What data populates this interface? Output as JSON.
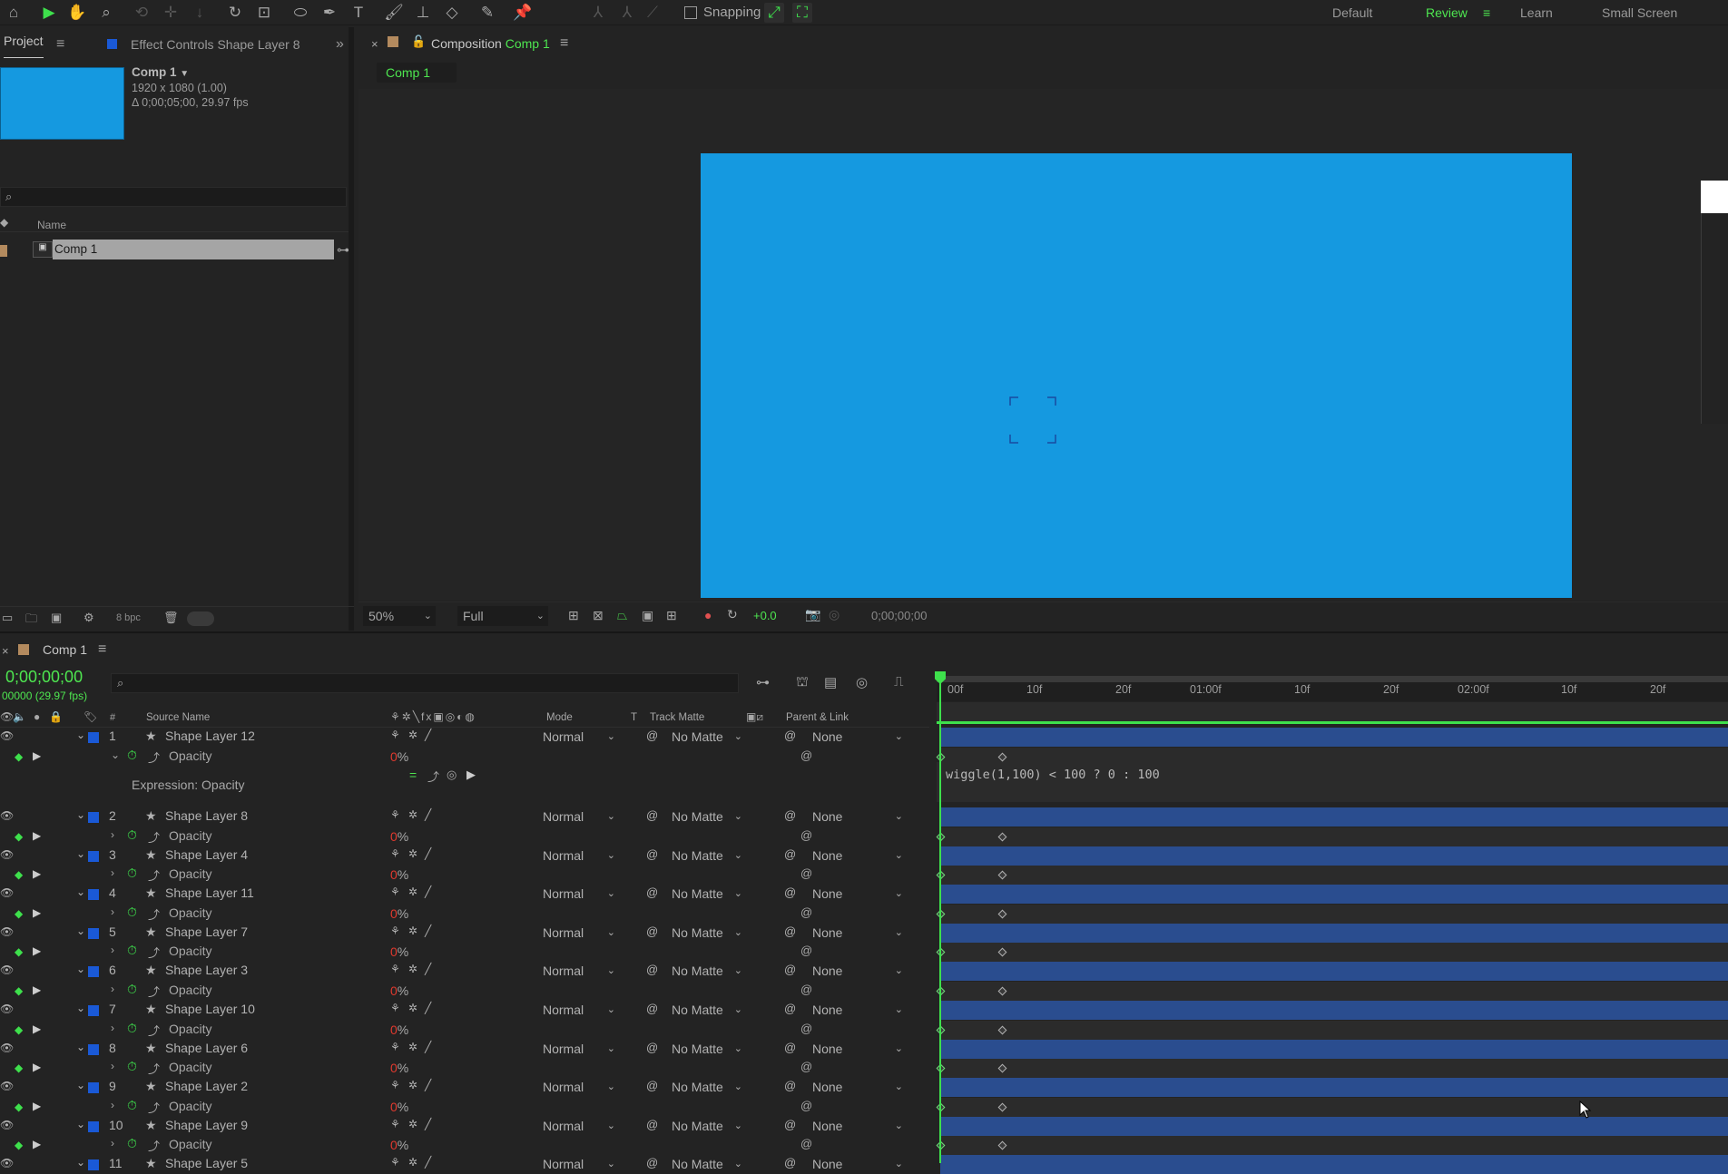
{
  "toolbar": {
    "snapping_label": "Snapping",
    "workspaces": [
      "Default",
      "Review",
      "Learn",
      "Small Screen"
    ],
    "active_workspace": "Review",
    "accent_color": "#3ee04c"
  },
  "project_panel": {
    "tab_project": "Project",
    "tab_effect_controls": "Effect Controls Shape Layer 8",
    "comp_name": "Comp 1",
    "comp_resolution": "1920 x 1080 (1.00)",
    "comp_duration": "Δ 0;00;05;00, 29.97 fps",
    "column_name": "Name",
    "items": [
      {
        "name": "Comp 1"
      }
    ],
    "bpc": "8 bpc"
  },
  "viewer": {
    "tab_label": "Composition",
    "tab_comp": "Comp 1",
    "breadcrumb": "Comp 1",
    "zoom": "50%",
    "resolution": "Full",
    "exposure": "+0.0",
    "timecode": "0;00;00;00",
    "canvas_color": "#1599e0"
  },
  "timeline": {
    "tab_label": "Comp 1",
    "current_time": "0;00;00;00",
    "frame_info": "00000 (29.97 fps)",
    "columns": {
      "number": "#",
      "source_name": "Source Name",
      "mode": "Mode",
      "t": "T",
      "track_matte": "Track Matte",
      "parent_link": "Parent & Link"
    },
    "ruler_ticks": [
      "00f",
      "10f",
      "20f",
      "01:00f",
      "10f",
      "20f",
      "02:00f",
      "10f",
      "20f"
    ],
    "expression_label": "Expression: Opacity",
    "expression_text": "wiggle(1,100) < 100 ? 0 : 100",
    "sub_property": "Opacity",
    "opacity_value": "0",
    "opacity_unit": "%",
    "layers": [
      {
        "num": "1",
        "name": "Shape Layer 12",
        "mode": "Normal",
        "matte": "No Matte",
        "parent": "None"
      },
      {
        "num": "2",
        "name": "Shape Layer 8",
        "mode": "Normal",
        "matte": "No Matte",
        "parent": "None"
      },
      {
        "num": "3",
        "name": "Shape Layer 4",
        "mode": "Normal",
        "matte": "No Matte",
        "parent": "None"
      },
      {
        "num": "4",
        "name": "Shape Layer 11",
        "mode": "Normal",
        "matte": "No Matte",
        "parent": "None"
      },
      {
        "num": "5",
        "name": "Shape Layer 7",
        "mode": "Normal",
        "matte": "No Matte",
        "parent": "None"
      },
      {
        "num": "6",
        "name": "Shape Layer 3",
        "mode": "Normal",
        "matte": "No Matte",
        "parent": "None"
      },
      {
        "num": "7",
        "name": "Shape Layer 10",
        "mode": "Normal",
        "matte": "No Matte",
        "parent": "None"
      },
      {
        "num": "8",
        "name": "Shape Layer 6",
        "mode": "Normal",
        "matte": "No Matte",
        "parent": "None"
      },
      {
        "num": "9",
        "name": "Shape Layer 2",
        "mode": "Normal",
        "matte": "No Matte",
        "parent": "None"
      },
      {
        "num": "10",
        "name": "Shape Layer 9",
        "mode": "Normal",
        "matte": "No Matte",
        "parent": "None"
      },
      {
        "num": "11",
        "name": "Shape Layer 5",
        "mode": "Normal",
        "matte": "No Matte",
        "parent": "None"
      }
    ]
  }
}
